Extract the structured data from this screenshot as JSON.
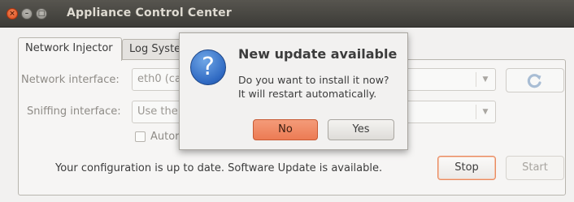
{
  "window": {
    "title": "Appliance Control Center",
    "controls": {
      "close": "×",
      "minimize": "–",
      "maximize": "□"
    }
  },
  "tabs": [
    {
      "label": "Network Injector",
      "active": true
    },
    {
      "label": "Log System",
      "active": false
    }
  ],
  "form": {
    "network_interface_label": "Network interface:",
    "network_interface_value": "eth0 (ca",
    "sniffing_interface_label": "Sniffing interface:",
    "sniffing_interface_value": "Use the",
    "auto_checkbox_label": "Autor",
    "combo_arrow": "▼"
  },
  "refresh_button": {
    "icon": "refresh-icon",
    "color": "#9fb6cf"
  },
  "status": {
    "text": "Your configuration is up to date. Software Update is available."
  },
  "actions": {
    "stop_label": "Stop",
    "start_label": "Start"
  },
  "dialog": {
    "icon": "question-icon",
    "icon_glyph": "?",
    "title": "New update available",
    "message_line1": "Do you want to install it now?",
    "message_line2": "It will restart automatically.",
    "no_label": "No",
    "yes_label": "Yes"
  },
  "colors": {
    "accent": "#ec7b54",
    "titlebar": "#3c3b37",
    "dialog_icon": "#2f69c2"
  }
}
